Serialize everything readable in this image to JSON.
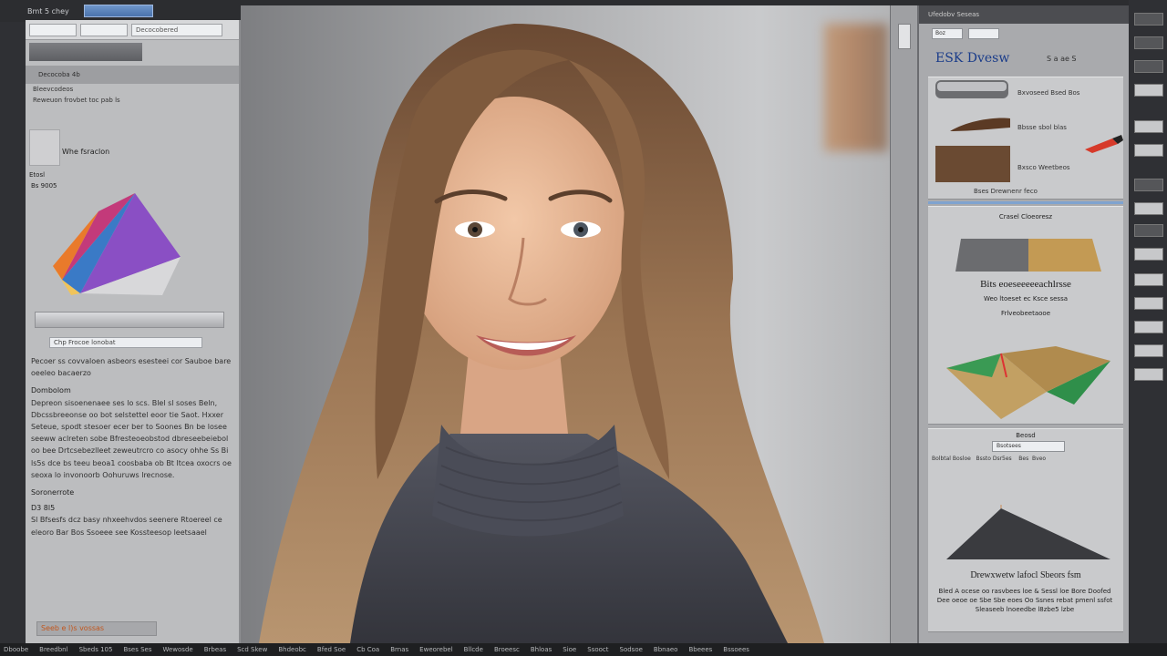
{
  "topbar": {
    "label": "Bmt 5 chey",
    "tab": ""
  },
  "left_panel": {
    "tool_a": "",
    "tool_b": "Decocobered",
    "dark_button": "",
    "section": "Decocoba 4b",
    "rows": [
      "Bleevcodeos",
      "Reweuon frovbet toc pab ls"
    ],
    "thumb_label": "Whe fsraclon",
    "side_notes": [
      "Etosl",
      "Bs 9005"
    ],
    "chip": "Chp Frocoe lonobat",
    "para1": "Pecoer ss covvaloen asbeors esesteei cor Sauboe bare oeeleo   bacaerzo",
    "heading": "Dombolom",
    "para2": "Depreon sisoenenaee ses lo scs. Blel sl soses Beln, Dbcssbreeonse oo bot selstettel eoor tie Saot. Hxxer Seteue, spodt stesoer ecer ber to Soones Bn be losee seeww aclreten sobe Bfresteoeobstod dbreseebeiebol oo bee Drtcsebezlleet zeweutrcro co asocy ohhe Ss Bi ls5s dce bs teeu beoa1 coosbaba ob Bt ltcea oxocrs oe seoxa lo invonoorb Oohuruws lrecnose.",
    "heading2": "Soronerrote",
    "note": "D3 8l5",
    "para3": "Sl Bfsesfs dcz basy nhxeehvdos seenere Rtoereel ce eleoro Bar Bos Ssoeee see Kossteesop leetsaael",
    "footer": "Seeb e l)s vossas"
  },
  "right_panel": {
    "top_label": "Ufedobv Seseas",
    "tabs": [
      "Boz",
      ""
    ],
    "title": "ESK Dvesw",
    "subtitle": "S a ae S",
    "items": [
      "Bxvoseed Bsed Bos",
      "Bbsse sbol blas",
      "Bxsco Weetbeos"
    ],
    "items_note": "Bses Drewnenr feco",
    "section": "Crasel Cloeoresz",
    "big_text": "Bits eoeseeeeeachlrsse",
    "big_sub": "Weo ltoeset ec Ksce sessa",
    "big_sub2": "Frlveobeetaooe",
    "mid_chip": "Bsotsees",
    "mid_row": "Bolbtal Bosloe   Bssto Dsr5es    Bes  Bveo",
    "mid_sub": "Beosd",
    "bottom_title": "Drewxwetw lafocl Sbeors fsm",
    "bottom_text": "Bled A ocese oo rasvbees loe & Sessl loe Bore Doofed Dee oeoe oe Sbe Sbe eoes Oo Ssnes rebat pmenl ssfot Sleaseeb lnoeedbe l8zbe5 lzbe"
  },
  "status_bar": [
    "Dboobe",
    "Breedbnl",
    "Sbeds 105",
    "Bses Ses",
    "Wewosde",
    "Brbeas",
    "Scd Skew",
    "Bhdeobc",
    "Bfed Soe",
    "Cb Coa",
    "Brnas",
    "Eweorebel",
    "Bllcde",
    "Broeesc",
    "Bhloas",
    "Sioe",
    "Ssooct",
    "Sodsoe",
    "Bbnaeo",
    "Bbeees",
    "Bssoees"
  ],
  "colors": {
    "accent": "#1a3c8a",
    "orange": "#c2571e",
    "highlight": "#4a73ad"
  }
}
